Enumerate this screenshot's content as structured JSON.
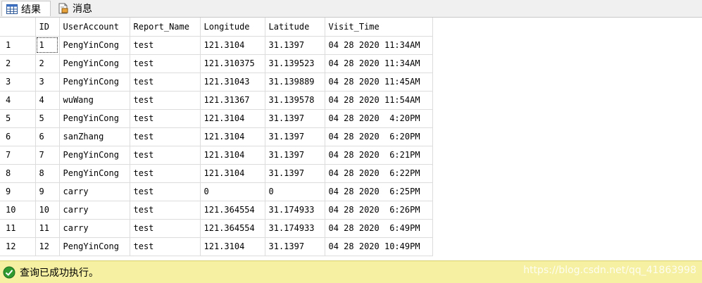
{
  "tabs": [
    {
      "label": "结果",
      "icon": "grid-icon",
      "active": true
    },
    {
      "label": "消息",
      "icon": "message-icon",
      "active": false
    }
  ],
  "columns": [
    "",
    "ID",
    "UserAccount",
    "Report_Name",
    "Longitude",
    "Latitude",
    "Visit_Time"
  ],
  "rows": [
    [
      "1",
      "1",
      "PengYinCong",
      "test",
      "121.3104",
      "31.1397",
      "04 28 2020 11:34AM"
    ],
    [
      "2",
      "2",
      "PengYinCong",
      "test",
      "121.310375",
      "31.139523",
      "04 28 2020 11:34AM"
    ],
    [
      "3",
      "3",
      "PengYinCong",
      "test",
      "121.31043",
      "31.139889",
      "04 28 2020 11:45AM"
    ],
    [
      "4",
      "4",
      "wuWang",
      "test",
      "121.31367",
      "31.139578",
      "04 28 2020 11:54AM"
    ],
    [
      "5",
      "5",
      "PengYinCong",
      "test",
      "121.3104",
      "31.1397",
      "04 28 2020  4:20PM"
    ],
    [
      "6",
      "6",
      "sanZhang",
      "test",
      "121.3104",
      "31.1397",
      "04 28 2020  6:20PM"
    ],
    [
      "7",
      "7",
      "PengYinCong",
      "test",
      "121.3104",
      "31.1397",
      "04 28 2020  6:21PM"
    ],
    [
      "8",
      "8",
      "PengYinCong",
      "test",
      "121.3104",
      "31.1397",
      "04 28 2020  6:22PM"
    ],
    [
      "9",
      "9",
      "carry",
      "test",
      "0",
      "0",
      "04 28 2020  6:25PM"
    ],
    [
      "10",
      "10",
      "carry",
      "test",
      "121.364554",
      "31.174933",
      "04 28 2020  6:26PM"
    ],
    [
      "11",
      "11",
      "carry",
      "test",
      "121.364554",
      "31.174933",
      "04 28 2020  6:49PM"
    ],
    [
      "12",
      "12",
      "PengYinCong",
      "test",
      "121.3104",
      "31.1397",
      "04 28 2020 10:49PM"
    ]
  ],
  "status": {
    "text": "查询已成功执行。",
    "icon": "check-circle-icon",
    "color": "#f5f0a2"
  },
  "watermark": "https://blog.csdn.net/qq_41863998"
}
